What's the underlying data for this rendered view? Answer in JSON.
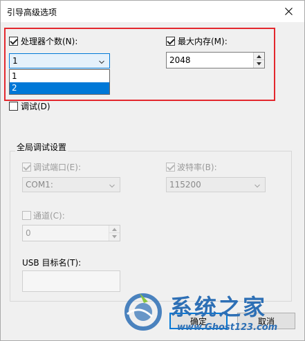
{
  "window": {
    "title": "引导高级选项"
  },
  "processors": {
    "label": "处理器个数(N):",
    "checked": true,
    "selected": "1",
    "options": [
      "1",
      "2"
    ],
    "highlighted_option": "2"
  },
  "memory": {
    "label": "最大内存(M):",
    "checked": true,
    "value": "2048"
  },
  "debug": {
    "label": "调试(D)",
    "checked": false
  },
  "global_debug": {
    "title": "全局调试设置",
    "port_label": "调试端口(E):",
    "port_value": "COM1:",
    "baud_label": "波特率(B):",
    "baud_value": "115200",
    "channel_label": "通道(C):",
    "channel_value": "0",
    "usb_label": "USB 目标名(T):",
    "usb_value": ""
  },
  "buttons": {
    "ok": "确定",
    "cancel": "取消"
  },
  "watermark": {
    "title": "系统之家",
    "url": "www.Ghost123.com"
  },
  "colors": {
    "highlight_border": "#e3272d",
    "accent": "#0078d7",
    "watermark": "#2d6fb5"
  }
}
